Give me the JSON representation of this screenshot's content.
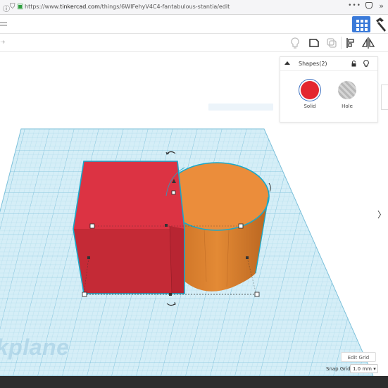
{
  "browser": {
    "url_prefix": "https://www.",
    "url_domain": "tinkercad.com",
    "url_path": "/things/6WIFehyV4C4-fantabulous-stantia/edit",
    "menu_dots": "•••"
  },
  "toolbar": {
    "tool_icons": [
      "bulb-icon",
      "note-icon",
      "duplicate-icon",
      "align-icon",
      "mirror-icon"
    ]
  },
  "workplane": {
    "label": "kplane"
  },
  "inspector": {
    "title": "Shapes(2)",
    "solid_label": "Solid",
    "hole_label": "Hole",
    "solid_color": "#e3262f",
    "selection_color": "#3b6fbf"
  },
  "shapes": [
    {
      "kind": "box",
      "color": "#d93240"
    },
    {
      "kind": "cylinder",
      "color": "#e78636"
    }
  ],
  "grid": {
    "edit_label": "Edit Grid",
    "snap_label": "Snap Grid",
    "snap_value": "1.0 mm ▾"
  }
}
